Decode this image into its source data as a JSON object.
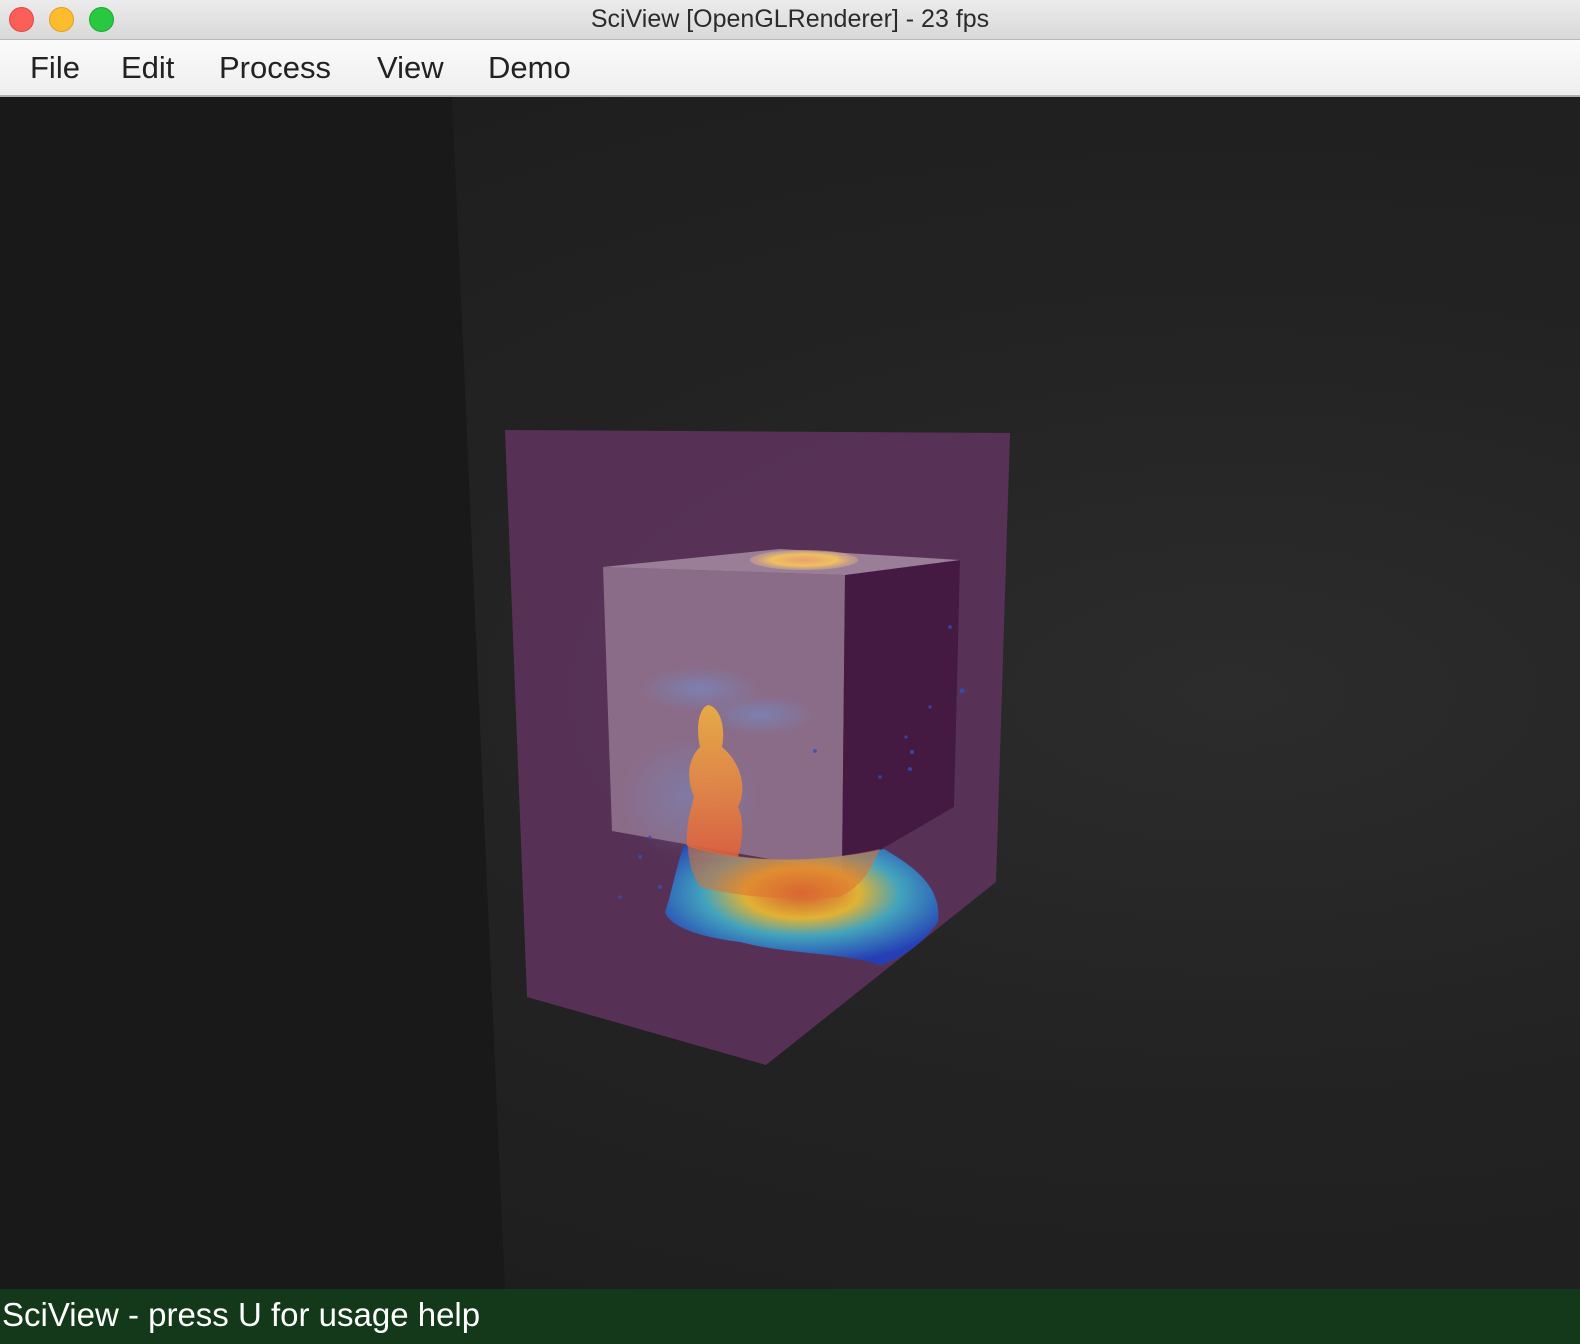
{
  "window": {
    "title": "SciView [OpenGLRenderer] - 23 fps"
  },
  "menu": {
    "items": [
      "File",
      "Edit",
      "Process",
      "View",
      "Demo"
    ]
  },
  "status": {
    "text": "SciView - press U for usage help"
  },
  "colors": {
    "statusbar": "#14381a",
    "volume_box": "#6a3a70",
    "inner_box": "#a88aa8"
  }
}
